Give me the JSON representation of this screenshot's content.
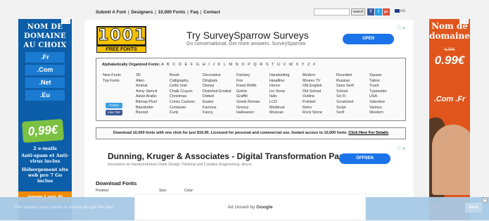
{
  "nav": {
    "items": [
      "Submit A Font",
      "Designers",
      "10,000 Fonts",
      "Faq",
      "Contact"
    ],
    "separator": "|"
  },
  "search": {
    "placeholder": "",
    "button_label": "search"
  },
  "social": {
    "facebook": "f",
    "twitter": "t",
    "gplus": "g+"
  },
  "language": "EN",
  "left_ad": {
    "close": "ⓘ ✕",
    "title": "Nom de domaine au choix",
    "domains": [
      ".Fr",
      ".Com",
      ".Net",
      ".Eu"
    ],
    "price": "0,99€",
    "price_small": "HT / an",
    "lines": [
      "2 e-mails",
      "Anti-spam et Anti-virus inclus",
      "Hébergement site web pro 7 Go inclus"
    ],
    "brand": "www.Lws.fr"
  },
  "right_ad": {
    "close": "ⓘ ✕",
    "title": "Nom de domaine",
    "old_price": "6,99€",
    "price": "0.99€",
    "ext": ".Com .Fr"
  },
  "logo": {
    "digits": "1001",
    "text": "FREE FONTS"
  },
  "ad1": {
    "title": "Try SurveySparrow Surveys",
    "sub": "Go conversational. Get more answers. SurveySparrow",
    "button": "OPEN",
    "close": "ⓘ ✕"
  },
  "alpha": {
    "header": "Alphabetically Organized Fonts:",
    "letters": "A B C D E F G H I J K L M N O P Q R S T U V W X Y Z #",
    "columns": [
      [
        "New Fonts",
        "Top Fonts"
      ],
      [
        "3D",
        "Alien",
        "Animal",
        "Army Stencil",
        "Asian Arabic",
        "Bitmap Pixel",
        "Blackletter",
        "Blurred"
      ],
      [
        "Brush",
        "Calligraphy",
        "Celtic Irish",
        "Chalk Crayon",
        "Christmas",
        "Comic Cartoon",
        "Computer",
        "Curly"
      ],
      [
        "Decorative",
        "Dingbats",
        "Disney",
        "Distorted Eroded",
        "Dotted",
        "Easter",
        "Famous",
        "Fancy"
      ],
      [
        "Fantasy",
        "Fire",
        "Fixed Width",
        "Gothic",
        "Graffiti",
        "Greek Roman",
        "Groovy",
        "Halloween"
      ],
      [
        "Handwriting",
        "Headline",
        "Horror",
        "Ice Snow",
        "Italic",
        "LCD",
        "Medieval",
        "Mexican"
      ],
      [
        "Modern",
        "Movies TV",
        "Old English",
        "Old School",
        "Outline",
        "Pointed",
        "Retro",
        "Rock Stone"
      ],
      [
        "Rounded",
        "Russian",
        "Sans Serif",
        "School",
        "Sci Fi",
        "Scratched",
        "Script",
        "Serif"
      ],
      [
        "Square",
        "Tattoo",
        "Trash",
        "Typewriter",
        "USA",
        "Valentine",
        "Various",
        "Western"
      ]
    ],
    "follow": "Follow",
    "like": "Like 75K"
  },
  "download_bar": {
    "text": "Download 10,000 fonts with one click for just $19.95. Licensed for personal and commercial use. Instant access to 10,000 fonts. ",
    "link": "Click Here For Details"
  },
  "ad2": {
    "title": "Dunning, Kruger & Associates - Digital Transformation Partner",
    "sub": "Innovation im Handumdrehen Dank Design Thinking und Creative Engineering. dka.io",
    "button": "ÖFFNEN",
    "close": "ⓘ ✕"
  },
  "download_fonts": {
    "title": "Download Fonts",
    "labels": [
      "Preview:",
      "Size:",
      "Color:"
    ]
  },
  "cookie": {
    "text": "This website uses cookies to ensure you get the best",
    "button": "Got it"
  },
  "ad_closed": {
    "prefix": "Ad closed by",
    "brand": "Google",
    "close": "✕"
  }
}
